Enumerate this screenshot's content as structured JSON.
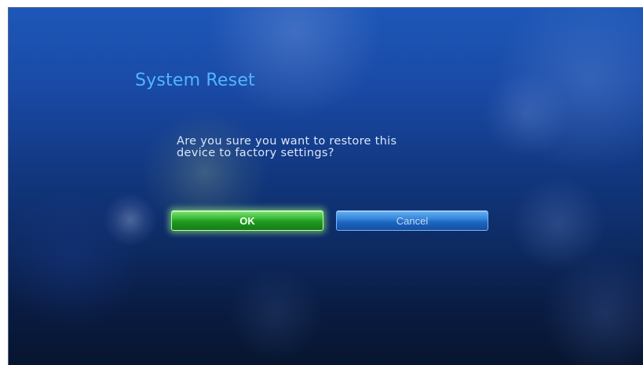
{
  "dialog": {
    "title": "System Reset",
    "message_line1": "Are you sure you want to restore this",
    "message_line2": "device to factory settings?",
    "ok_label": "OK",
    "cancel_label": "Cancel"
  },
  "colors": {
    "title": "#4fb6ff",
    "message_text": "#d8e6f8",
    "ok_button": "#2aa82a",
    "cancel_button": "#2a78d0",
    "background_top": "#1d57b8",
    "background_bottom": "#07152f"
  }
}
